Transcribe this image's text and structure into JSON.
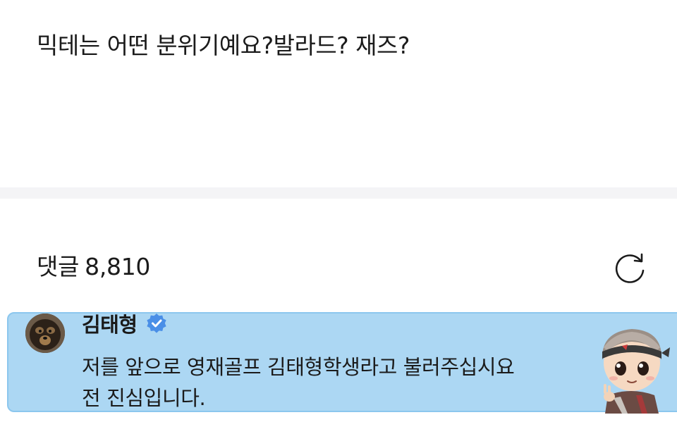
{
  "post": {
    "text": "믹테는 어떤 분위기예요?발라드? 재즈?"
  },
  "comments_section": {
    "label": "댓글",
    "count": "8,810",
    "refresh_icon": "refresh-icon"
  },
  "comment": {
    "author": "김태형",
    "verified_icon": "verified-badge-icon",
    "lines": [
      "저를 앞으로 영재골프 김태형학생라고 불러주십시요",
      "전 진심입니다."
    ],
    "card_color": "#acd7f3",
    "badge_color": "#4a8fe7"
  }
}
